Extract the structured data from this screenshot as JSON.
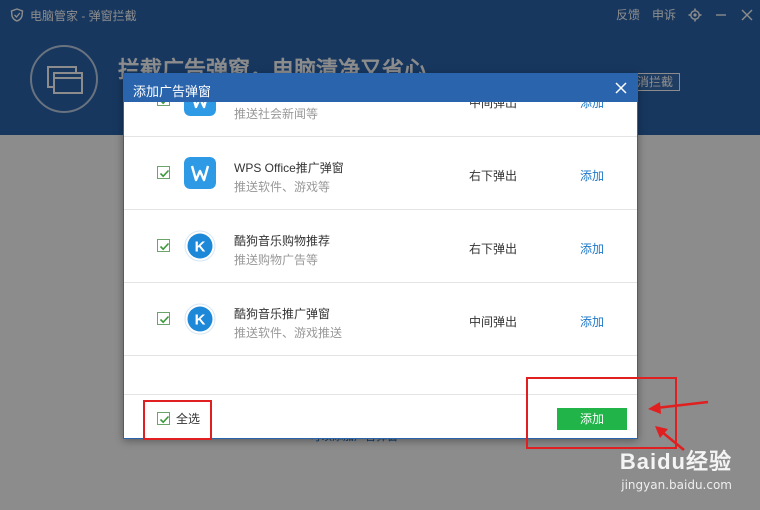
{
  "app": {
    "title": "电脑管家 - 弹窗拦截",
    "menu_feedback": "反馈",
    "menu_complaint": "申诉",
    "hero_title": "拦截广告弹窗，电脑清净又省心",
    "hero_button": "消拦截",
    "body_link": "可以添加广告弹窗"
  },
  "dialog": {
    "title": "添加广告弹窗",
    "items": [
      {
        "name": "",
        "desc": "推送社会新闻等",
        "position": "中间弹出",
        "action": "添加",
        "icon": "wps-icon",
        "checked": true
      },
      {
        "name": "WPS Office推广弹窗",
        "desc": "推送软件、游戏等",
        "position": "右下弹出",
        "action": "添加",
        "icon": "wps-icon",
        "checked": true
      },
      {
        "name": "酷狗音乐购物推荐",
        "desc": "推送购物广告等",
        "position": "右下弹出",
        "action": "添加",
        "icon": "kugou-icon",
        "checked": true
      },
      {
        "name": "酷狗音乐推广弹窗",
        "desc": "推送软件、游戏推送",
        "position": "中间弹出",
        "action": "添加",
        "icon": "kugou-icon",
        "checked": true
      }
    ],
    "select_all_label": "全选",
    "select_all_checked": true,
    "add_button": "添加"
  },
  "watermark": {
    "brand": "Baidu经验",
    "url": "jingyan.baidu.com"
  },
  "colors": {
    "header_blue": "#2a64ad",
    "link_blue": "#1f78c8",
    "button_green": "#21b449",
    "annotation_red": "#e02020"
  }
}
